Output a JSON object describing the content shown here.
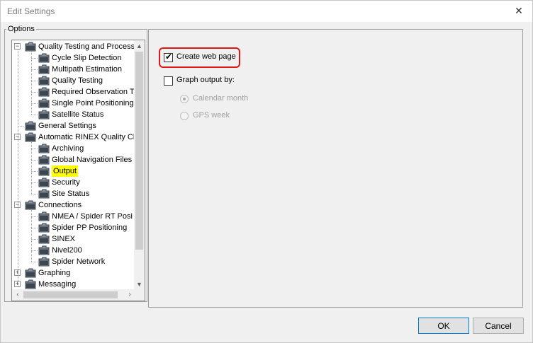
{
  "window": {
    "title": "Edit Settings",
    "close_glyph": "✕"
  },
  "options_group": {
    "legend": "Options"
  },
  "tree": {
    "nodes": [
      {
        "label": "Quality Testing and Process",
        "level": 0,
        "expander": "−"
      },
      {
        "label": "Cycle Slip Detection",
        "level": 1
      },
      {
        "label": "Multipath Estimation",
        "level": 1
      },
      {
        "label": "Quality Testing",
        "level": 1
      },
      {
        "label": "Required Observation T",
        "level": 1
      },
      {
        "label": "Single Point Positioning",
        "level": 1
      },
      {
        "label": "Satellite Status",
        "level": 1
      },
      {
        "label": "General Settings",
        "level": 0
      },
      {
        "label": "Automatic RINEX Quality Ch",
        "level": 0,
        "expander": "−"
      },
      {
        "label": "Archiving",
        "level": 1
      },
      {
        "label": "Global Navigation Files",
        "level": 1
      },
      {
        "label": "Output",
        "level": 1,
        "selected": true
      },
      {
        "label": "Security",
        "level": 1
      },
      {
        "label": "Site Status",
        "level": 1
      },
      {
        "label": "Connections",
        "level": 0,
        "expander": "−"
      },
      {
        "label": "NMEA / Spider RT Posi",
        "level": 1
      },
      {
        "label": "Spider PP Positioning",
        "level": 1
      },
      {
        "label": "SINEX",
        "level": 1
      },
      {
        "label": "Nivel200",
        "level": 1
      },
      {
        "label": "Spider Network",
        "level": 1
      },
      {
        "label": "Graphing",
        "level": 0,
        "expander": "+"
      },
      {
        "label": "Messaging",
        "level": 0,
        "expander": "+"
      }
    ],
    "scroll_up": "▲",
    "scroll_down": "▼",
    "scroll_left": "‹",
    "scroll_right": "›"
  },
  "settings": {
    "create_web_page": {
      "label": "Create web page",
      "checked": true,
      "tick": "✔"
    },
    "graph_output": {
      "label": "Graph output by:",
      "checked": false
    },
    "calendar_month": {
      "label": "Calendar month"
    },
    "gps_week": {
      "label": "GPS week"
    }
  },
  "buttons": {
    "ok": "OK",
    "cancel": "Cancel"
  },
  "colors": {
    "highlight": "#ffff00",
    "annotation": "#e01515",
    "folder_dark": "#3c4650",
    "folder_light": "#8a96a0"
  }
}
